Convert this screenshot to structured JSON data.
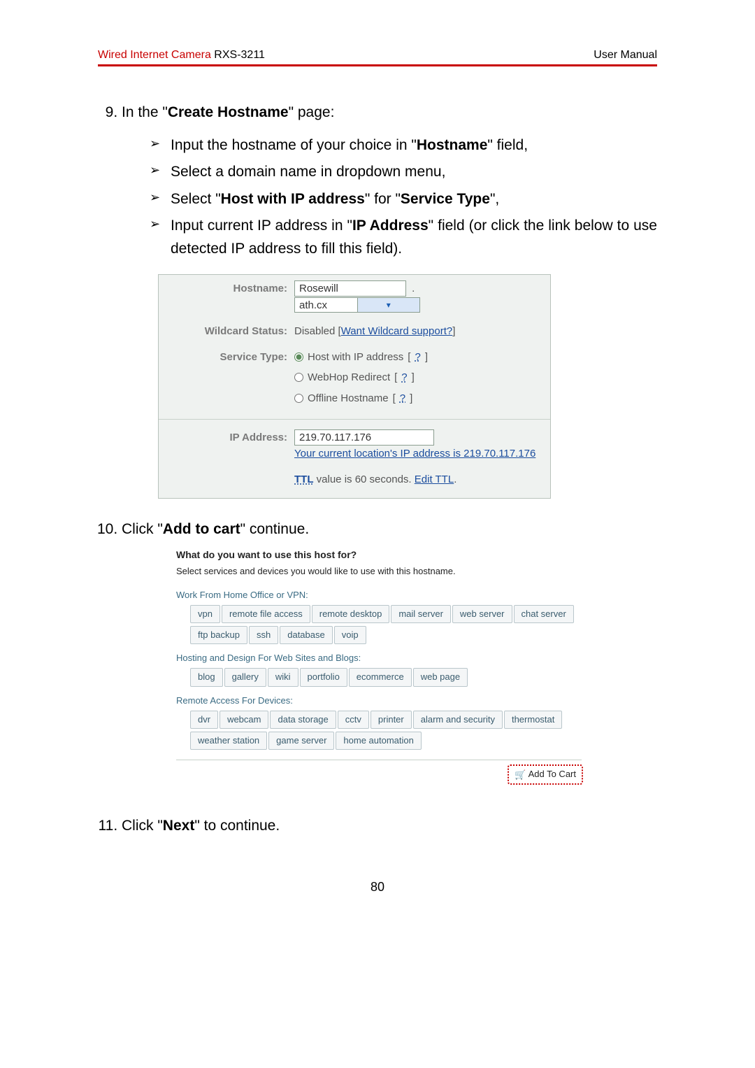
{
  "header": {
    "product_red": "Wired Internet Camera",
    "product_model": " RXS-3211",
    "right": "User Manual"
  },
  "step9": {
    "intro_pre": "In the \"",
    "intro_bold": "Create Hostname",
    "intro_post": "\" page:",
    "bullets": [
      {
        "pre": "Input the hostname of your choice in \"",
        "b1": "Hostname",
        "post": "\" field,"
      },
      {
        "pre": "Select a domain name in dropdown menu,",
        "b1": "",
        "post": ""
      },
      {
        "pre": "Select \"",
        "b1": "Host with IP address",
        "mid": "\" for \"",
        "b2": "Service Type",
        "post": "\","
      },
      {
        "pre": "Input current IP address in \"",
        "b1": "IP Address",
        "post": "\" field (or click the link below to use detected IP address to fill this field)."
      }
    ]
  },
  "form1": {
    "labels": {
      "hostname": "Hostname:",
      "wildcard": "Wildcard Status:",
      "service": "Service Type:",
      "ip": "IP Address:"
    },
    "hostname_value": "Rosewill",
    "domain_sep": ".",
    "domain_value": "ath.cx",
    "wildcard_pre": "Disabled [",
    "wildcard_link": "Want Wildcard support?",
    "wildcard_post": "]",
    "radios": [
      {
        "label": "Host with IP address",
        "q": "?",
        "checked": true
      },
      {
        "label": "WebHop Redirect",
        "q": "?",
        "checked": false
      },
      {
        "label": "Offline Hostname",
        "q": "?",
        "checked": false
      }
    ],
    "ip_value": "219.70.117.176",
    "ip_link": "Your current location's IP address is 219.70.117.176",
    "ttl_lead": "TTL",
    "ttl_mid": " value is 60 seconds. ",
    "ttl_link": "Edit TTL",
    "ttl_post": "."
  },
  "step10": {
    "pre": "Click \"",
    "bold": "Add to cart",
    "post": "\" continue."
  },
  "form2": {
    "heading": "What do you want to use this host for?",
    "sub": "Select services and devices you would like to use with this hostname.",
    "groups": [
      {
        "title": "Work From Home Office or VPN:",
        "tags": [
          "vpn",
          "remote file access",
          "remote desktop",
          "mail server",
          "web server",
          "chat server",
          "ftp backup",
          "ssh",
          "database",
          "voip"
        ]
      },
      {
        "title": "Hosting and Design For Web Sites and Blogs:",
        "tags": [
          "blog",
          "gallery",
          "wiki",
          "portfolio",
          "ecommerce",
          "web page"
        ]
      },
      {
        "title": "Remote Access For Devices:",
        "tags": [
          "dvr",
          "webcam",
          "data storage",
          "cctv",
          "printer",
          "alarm and security",
          "thermostat",
          "weather station",
          "game server",
          "home automation"
        ]
      }
    ],
    "cart_button": "Add To Cart"
  },
  "step11": {
    "pre": "Click \"",
    "bold": "Next",
    "post": "\" to continue."
  },
  "page_no": "80"
}
